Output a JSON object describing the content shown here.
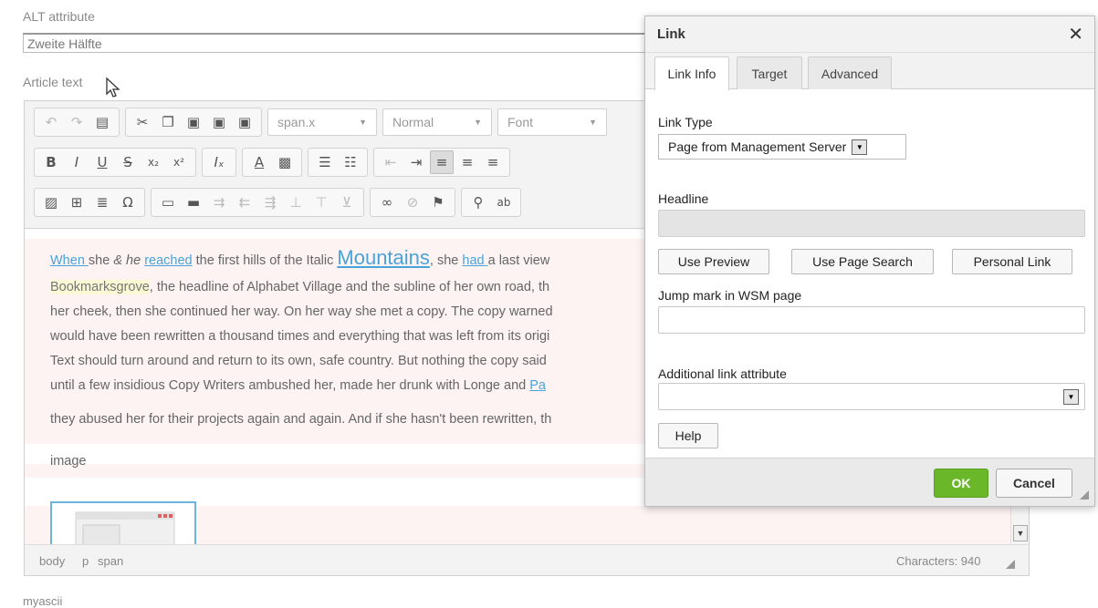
{
  "form": {
    "alt_label": "ALT attribute",
    "alt_value": "Zweite Hälfte",
    "article_label": "Article text",
    "next_label": "myascii"
  },
  "editor": {
    "combos": {
      "styles": "span.x",
      "format": "Normal",
      "font": "Font"
    },
    "content": {
      "line1_when": "When ",
      "line1_a": "she ",
      "line1_b": "& he",
      "line1_c": " ",
      "line1_reached": "reached",
      "line1_d": " the first hills of the Italic ",
      "line1_mountains": "Mountains",
      "line1_e": ", she ",
      "line1_had": "had ",
      "line1_f": "a last view",
      "line2_bookmarks": "Bookmarksgrove",
      "line2_rest": ", the headline of Alphabet Village and the subline of her own road, th",
      "line3": "her cheek, then she continued her way. On her way she met a copy. The copy warned",
      "line4": "would have been rewritten a thousand times and everything that was left from its origi",
      "line5": "Text should turn around and return to its own, safe country. But nothing the copy said",
      "line6_a": "until a few insidious Copy Writers ambushed her, made her drunk with Longe and ",
      "line6_link": "Pa",
      "line7": "they abused her for their projects again and again. And if she hasn't been rewritten, th",
      "image_label": "image"
    },
    "status": {
      "path": [
        "body",
        "p",
        "span"
      ],
      "characters": "Characters: 940"
    }
  },
  "dialog": {
    "title": "Link",
    "close_glyph": "✕",
    "tabs": [
      {
        "label": "Link Info"
      },
      {
        "label": "Target"
      },
      {
        "label": "Advanced"
      }
    ],
    "link_type_label": "Link Type",
    "link_type_value": "Page from Management Server",
    "headline_label": "Headline",
    "buttons": {
      "use_preview": "Use Preview",
      "use_page_search": "Use Page Search",
      "personal_link": "Personal Link",
      "help": "Help",
      "ok": "OK",
      "cancel": "Cancel"
    },
    "jump_mark_label": "Jump mark in WSM page",
    "additional_attr_label": "Additional link attribute"
  },
  "colors": {
    "ok_button": "#6ab82a",
    "link_text": "#4aa3d8",
    "highlight": "#fbf8d4"
  }
}
